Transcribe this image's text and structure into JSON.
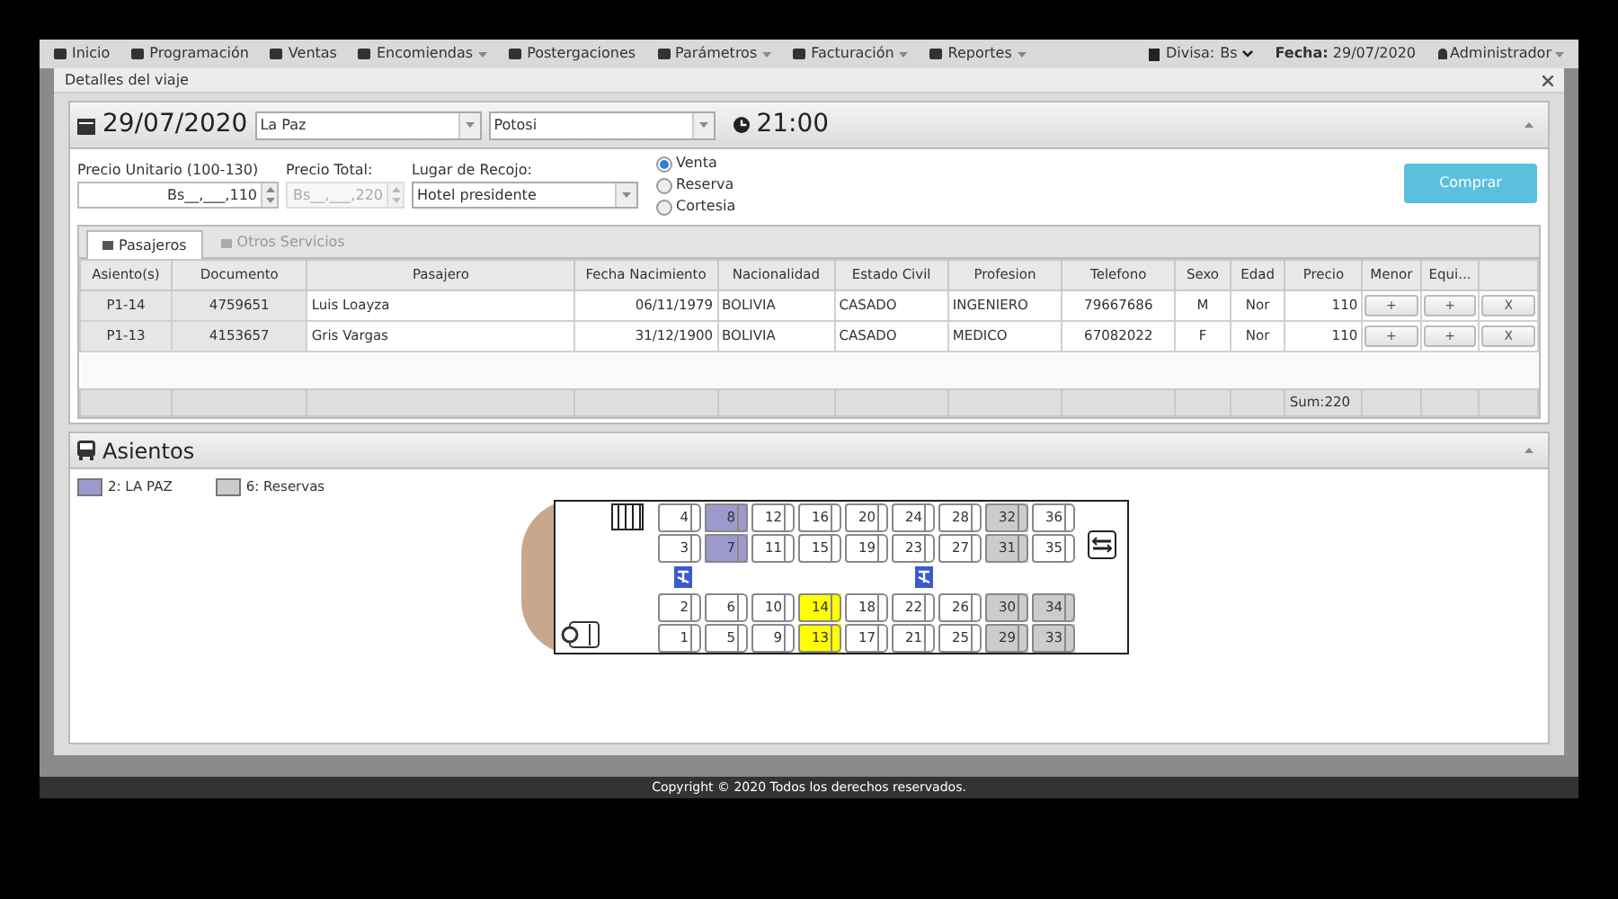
{
  "nav": {
    "items": [
      {
        "label": "Inicio",
        "dropdown": false
      },
      {
        "label": "Programación",
        "dropdown": false
      },
      {
        "label": "Ventas",
        "dropdown": false
      },
      {
        "label": "Encomiendas",
        "dropdown": true
      },
      {
        "label": "Postergaciones",
        "dropdown": false
      },
      {
        "label": "Parámetros",
        "dropdown": true
      },
      {
        "label": "Facturación",
        "dropdown": true
      },
      {
        "label": "Reportes",
        "dropdown": true
      }
    ],
    "currency_label": "Divisa:",
    "currency": "Bs",
    "date_label": "Fecha:",
    "date": "29/07/2020",
    "user": "Administrador"
  },
  "dialog": {
    "title": "Detalles del viaje"
  },
  "trip": {
    "date": "29/07/2020",
    "origin": "La Paz",
    "destination": "Potosi",
    "time": "21:00"
  },
  "form": {
    "unit_price_label": "Precio Unitario (100-130)",
    "unit_price": "Bs__,___,110",
    "total_price_label": "Precio Total:",
    "total_price": "Bs__,___,220",
    "pickup_label": "Lugar de Recojo:",
    "pickup": "Hotel presidente",
    "sale_types": [
      {
        "label": "Venta",
        "selected": true
      },
      {
        "label": "Reserva",
        "selected": false
      },
      {
        "label": "Cortesia",
        "selected": false
      }
    ],
    "buy_button": "Comprar"
  },
  "tabs": [
    {
      "label": "Pasajeros",
      "selected": true
    },
    {
      "label": "Otros Servicios",
      "selected": false
    }
  ],
  "table": {
    "columns": [
      "Asiento(s)",
      "Documento",
      "Pasajero",
      "Fecha Nacimiento",
      "Nacionalidad",
      "Estado Civil",
      "Profesion",
      "Telefono",
      "Sexo",
      "Edad",
      "Precio",
      "Menor",
      "Equi...",
      ""
    ],
    "rows": [
      {
        "cells": [
          "P1-14",
          "4759651",
          "Luis Loayza",
          "06/11/1979",
          "BOLIVIA",
          "CASADO",
          "INGENIERO",
          "79667686",
          "M",
          "Nor",
          "110"
        ],
        "buttons": [
          "+",
          "+",
          "X"
        ]
      },
      {
        "cells": [
          "P1-13",
          "4153657",
          "Gris Vargas",
          "31/12/1900",
          "BOLIVIA",
          "CASADO",
          "MEDICO",
          "67082022",
          "F",
          "Nor",
          "110"
        ],
        "buttons": [
          "+",
          "+",
          "X"
        ]
      }
    ],
    "sum": "Sum:220"
  },
  "seats_panel": {
    "title": "Asientos",
    "legend": [
      {
        "label": "2: LA PAZ",
        "color": "#9d99cc"
      },
      {
        "label": "6: Reservas",
        "color": "#cccccc"
      }
    ],
    "seat_rows": [
      [
        {
          "number": "4",
          "kind": "free"
        },
        {
          "number": "8",
          "kind": "sold"
        },
        {
          "number": "12",
          "kind": "free"
        },
        {
          "number": "16",
          "kind": "free"
        },
        {
          "number": "20",
          "kind": "free"
        },
        {
          "number": "24",
          "kind": "free"
        },
        {
          "number": "28",
          "kind": "free"
        },
        {
          "number": "32",
          "kind": "reserved"
        },
        {
          "number": "36",
          "kind": "free"
        }
      ],
      [
        {
          "number": "3",
          "kind": "free"
        },
        {
          "number": "7",
          "kind": "sold"
        },
        {
          "number": "11",
          "kind": "free"
        },
        {
          "number": "15",
          "kind": "free"
        },
        {
          "number": "19",
          "kind": "free"
        },
        {
          "number": "23",
          "kind": "free"
        },
        {
          "number": "27",
          "kind": "free"
        },
        {
          "number": "31",
          "kind": "reserved"
        },
        {
          "number": "35",
          "kind": "free"
        }
      ],
      [
        {
          "number": "2",
          "kind": "free"
        },
        {
          "number": "6",
          "kind": "free"
        },
        {
          "number": "10",
          "kind": "free"
        },
        {
          "number": "14",
          "kind": "selected"
        },
        {
          "number": "18",
          "kind": "free"
        },
        {
          "number": "22",
          "kind": "free"
        },
        {
          "number": "26",
          "kind": "free"
        },
        {
          "number": "30",
          "kind": "reserved"
        },
        {
          "number": "34",
          "kind": "reserved"
        }
      ],
      [
        {
          "number": "1",
          "kind": "free"
        },
        {
          "number": "5",
          "kind": "free"
        },
        {
          "number": "9",
          "kind": "free"
        },
        {
          "number": "13",
          "kind": "selected"
        },
        {
          "number": "17",
          "kind": "free"
        },
        {
          "number": "21",
          "kind": "free"
        },
        {
          "number": "25",
          "kind": "free"
        },
        {
          "number": "29",
          "kind": "reserved"
        },
        {
          "number": "33",
          "kind": "reserved"
        }
      ]
    ]
  },
  "footer": "Copyright © 2020 Todos los derechos reservados."
}
